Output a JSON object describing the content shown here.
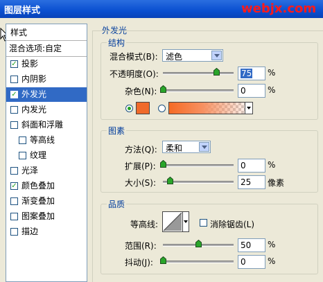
{
  "window": {
    "title": "图层样式",
    "watermark": "webjx.com"
  },
  "sidebar": {
    "header": "样式",
    "items": [
      {
        "label": "混合选项:自定",
        "checkbox": false,
        "checked": false,
        "selected": false,
        "indent": 0
      },
      {
        "label": "投影",
        "checkbox": true,
        "checked": true,
        "selected": false,
        "indent": 0
      },
      {
        "label": "内阴影",
        "checkbox": true,
        "checked": false,
        "selected": false,
        "indent": 0
      },
      {
        "label": "外发光",
        "checkbox": true,
        "checked": true,
        "selected": true,
        "indent": 0
      },
      {
        "label": "内发光",
        "checkbox": true,
        "checked": false,
        "selected": false,
        "indent": 0
      },
      {
        "label": "斜面和浮雕",
        "checkbox": true,
        "checked": false,
        "selected": false,
        "indent": 0
      },
      {
        "label": "等高线",
        "checkbox": true,
        "checked": false,
        "selected": false,
        "indent": 1
      },
      {
        "label": "纹理",
        "checkbox": true,
        "checked": false,
        "selected": false,
        "indent": 1
      },
      {
        "label": "光泽",
        "checkbox": true,
        "checked": false,
        "selected": false,
        "indent": 0
      },
      {
        "label": "颜色叠加",
        "checkbox": true,
        "checked": true,
        "selected": false,
        "indent": 0
      },
      {
        "label": "渐变叠加",
        "checkbox": true,
        "checked": false,
        "selected": false,
        "indent": 0
      },
      {
        "label": "图案叠加",
        "checkbox": true,
        "checked": false,
        "selected": false,
        "indent": 0
      },
      {
        "label": "描边",
        "checkbox": true,
        "checked": false,
        "selected": false,
        "indent": 0
      }
    ]
  },
  "panel": {
    "title": "外发光",
    "structure": {
      "title": "结构",
      "blend_mode_label": "混合模式(B):",
      "blend_mode_value": "滤色",
      "opacity_label": "不透明度(O):",
      "opacity_value": "75",
      "opacity_fraction": 0.75,
      "noise_label": "杂色(N):",
      "noise_value": "0",
      "noise_fraction": 0.0,
      "unit_percent": "%",
      "color_solid": "#f06a2a",
      "radio_solid_on": true
    },
    "elements": {
      "title": "图素",
      "method_label": "方法(Q):",
      "method_value": "柔和",
      "spread_label": "扩展(P):",
      "spread_value": "0",
      "spread_fraction": 0.0,
      "size_label": "大小(S):",
      "size_value": "25",
      "size_fraction": 0.1,
      "unit_pixel": "像素"
    },
    "quality": {
      "title": "品质",
      "contour_label": "等高线:",
      "antialias_label": "消除锯齿(L)",
      "antialias_checked": false,
      "range_label": "范围(R):",
      "range_value": "50",
      "range_fraction": 0.5,
      "jitter_label": "抖动(J):",
      "jitter_value": "0",
      "jitter_fraction": 0.0
    }
  },
  "colors": {
    "title_bar": "#0a4fd0",
    "selection": "#316ac5",
    "group_title": "#003c9c",
    "watermark": "#ff1a1a"
  }
}
